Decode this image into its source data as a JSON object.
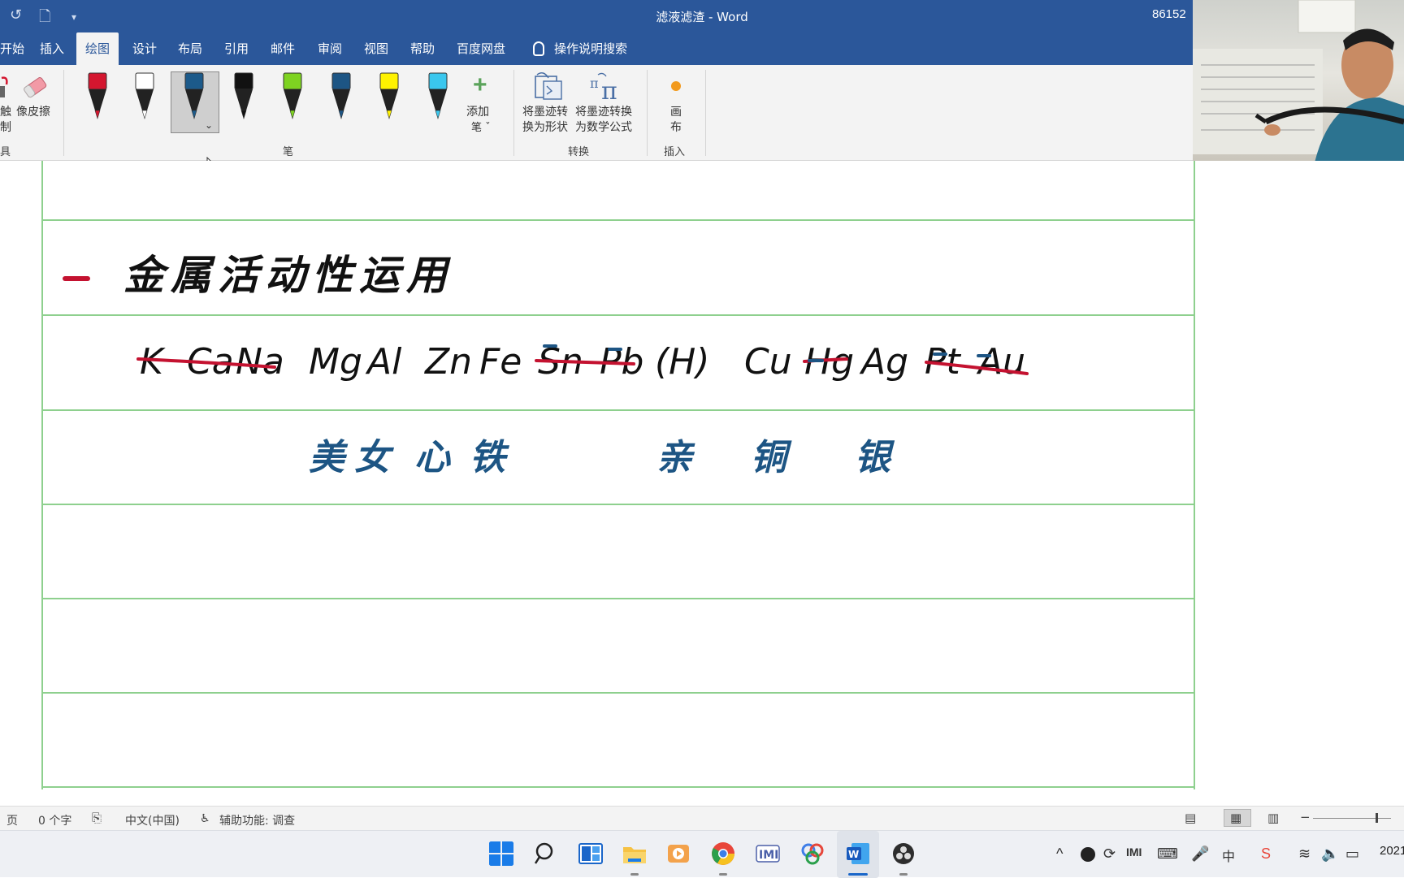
{
  "app": {
    "title": "滤液滤渣 - Word",
    "user_fragment": "86152"
  },
  "quick_access": {
    "undo_icon": "undo-icon",
    "new_doc_icon": "new-document-icon",
    "customize_icon": "chevron-down-icon"
  },
  "tabs": [
    "开始",
    "插入",
    "绘图",
    "设计",
    "布局",
    "引用",
    "邮件",
    "审阅",
    "视图",
    "帮助",
    "百度网盘",
    "操作说明搜索"
  ],
  "active_tab": "绘图",
  "ribbon": {
    "touch_label_1": "触",
    "touch_label_2": "制",
    "tools_group_fragment": "具",
    "eraser_label": "像皮擦",
    "pens_group": "笔",
    "add_pen_label_1": "添加",
    "add_pen_label_2": "笔 ˇ",
    "convert_shape_1": "将墨迹转",
    "convert_shape_2": "换为形状",
    "convert_math_1": "将墨迹转换",
    "convert_math_2": "为数学公式",
    "convert_group": "转换",
    "canvas_label_1": "画",
    "canvas_label_2": "布",
    "insert_group": "插入",
    "pen_colors": [
      "#d4162f",
      "#ffffff",
      "#1c5a8a",
      "#111111",
      "#7ed321",
      "#1d5584",
      "#fff200",
      "#3ac7ee"
    ]
  },
  "document": {
    "heading_bullet": "一",
    "heading": "金属活动性运用",
    "series_struck": [
      "K",
      "Ca",
      "Na"
    ],
    "series": [
      "Mg",
      "Al",
      "Zn",
      "Fe",
      "Sn",
      "Pb",
      "(H)",
      "Cu",
      "Hg",
      "Ag",
      "Pt",
      "Au"
    ],
    "mnemonics": [
      "美",
      "女",
      "心",
      "铁",
      "亲",
      "铜",
      "银"
    ],
    "ink_colors": {
      "text": "#111111",
      "strike": "#c41230",
      "mnemonic": "#1d5584"
    }
  },
  "status": {
    "page_fragment": "页",
    "word_count": "0 个字",
    "language": "中文(中国)",
    "accessibility": "辅助功能: 调查"
  },
  "taskbar": {
    "clock_fragment": "2021"
  }
}
